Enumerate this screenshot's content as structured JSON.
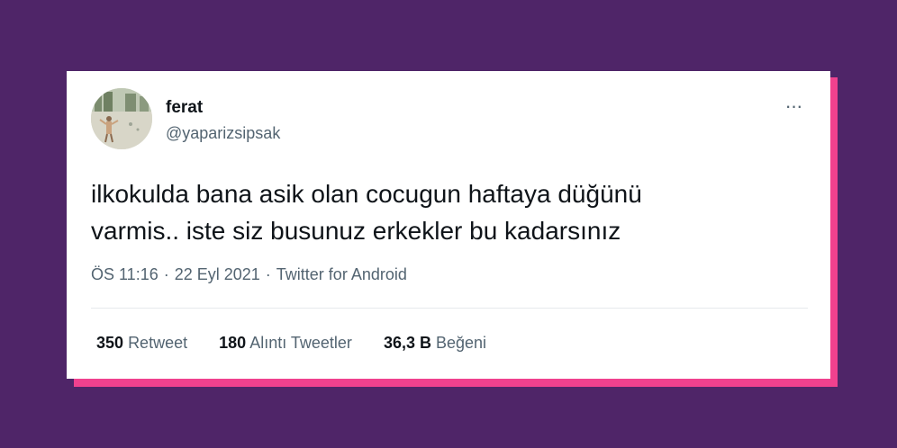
{
  "tweet": {
    "display_name": "ferat",
    "handle": "@yaparizsipsak",
    "more_label": "···",
    "text_line1": "ilkokulda bana asik olan cocugun haftaya düğünü",
    "text_line2": "varmis.. iste siz busunuz erkekler bu kadarsınız",
    "time": "ÖS 11:16",
    "date": "22 Eyl 2021",
    "source": "Twitter for Android",
    "separator": "·",
    "stats": [
      {
        "value": "350",
        "label": "Retweet"
      },
      {
        "value": "180",
        "label": "Alıntı Tweetler"
      },
      {
        "value": "36,3 B",
        "label": "Beğeni"
      }
    ]
  },
  "colors": {
    "background": "#4f2568",
    "card_shadow": "#f0418e",
    "card": "#ffffff",
    "primary_text": "#0f1419",
    "secondary_text": "#536471"
  },
  "icons": {
    "more": "more-horizontal-icon",
    "avatar": "profile-photo"
  }
}
